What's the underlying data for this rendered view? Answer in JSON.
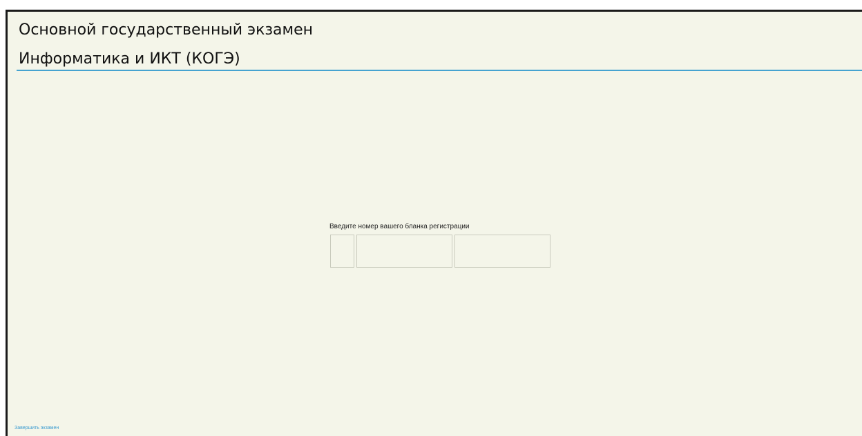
{
  "header": {
    "title_line1": "Основной государственный экзамен",
    "title_line2": "Информатика и ИКТ (КОГЭ)"
  },
  "registration": {
    "label": "Введите номер вашего бланка регистрации",
    "fields": [
      {
        "value": ""
      },
      {
        "value": ""
      },
      {
        "value": ""
      }
    ]
  },
  "footer": {
    "finish_label": "Завершить экзамен"
  },
  "colors": {
    "background": "#f4f5e9",
    "accent_line": "#45a3d0",
    "link": "#3a9bd0"
  }
}
